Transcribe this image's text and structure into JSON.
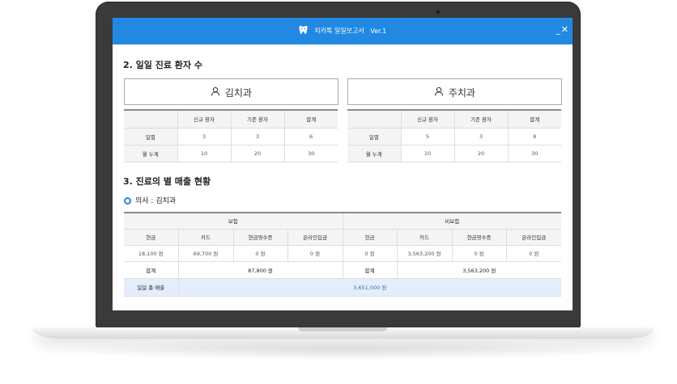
{
  "window": {
    "title": "치카톡 일일보고서",
    "version": "Ver.1",
    "minimize_label": "_",
    "close_label": "✕"
  },
  "section2": {
    "title": "2. 일일 진료 환자 수",
    "panels": [
      {
        "dept": "김치과",
        "columns": [
          "신규 환자",
          "기존 환자",
          "합계"
        ],
        "rows": [
          {
            "label": "일별",
            "values": [
              "3",
              "3",
              "6"
            ]
          },
          {
            "label": "월 누계",
            "values": [
              "10",
              "20",
              "30"
            ]
          }
        ]
      },
      {
        "dept": "주치과",
        "columns": [
          "신규 환자",
          "기존 환자",
          "합계"
        ],
        "rows": [
          {
            "label": "일별",
            "values": [
              "5",
              "3",
              "8"
            ]
          },
          {
            "label": "월 누계",
            "values": [
              "10",
              "20",
              "30"
            ]
          }
        ]
      }
    ]
  },
  "section3": {
    "title": "3. 진료의 별 매출 현황",
    "doctor_label": "의사 : 김치과",
    "insured_label": "보험",
    "uninsured_label": "비보험",
    "columns": [
      "현금",
      "카드",
      "현금영수증",
      "온라인입금",
      "현금",
      "카드",
      "현금영수증",
      "온라인입금"
    ],
    "values": [
      "18,100 원",
      "69,700 원",
      "0 원",
      "0 원",
      "0 원",
      "3,563,200 원",
      "0 원",
      "0 원"
    ],
    "total_label_insured": "합계",
    "total_insured": "87,800 원",
    "total_label_uninsured": "합계",
    "total_uninsured": "3,563,200 원",
    "daily_total_label": "일일 총 매출",
    "daily_total": "3,651,000 원"
  },
  "colors": {
    "titlebar": "#2289e2",
    "accent": "#2289e2",
    "highlight_row": "#e3eefa"
  },
  "icons": {
    "app": "tooth-icon",
    "dept": "user-icon",
    "doctor": "radio-selected-icon"
  }
}
